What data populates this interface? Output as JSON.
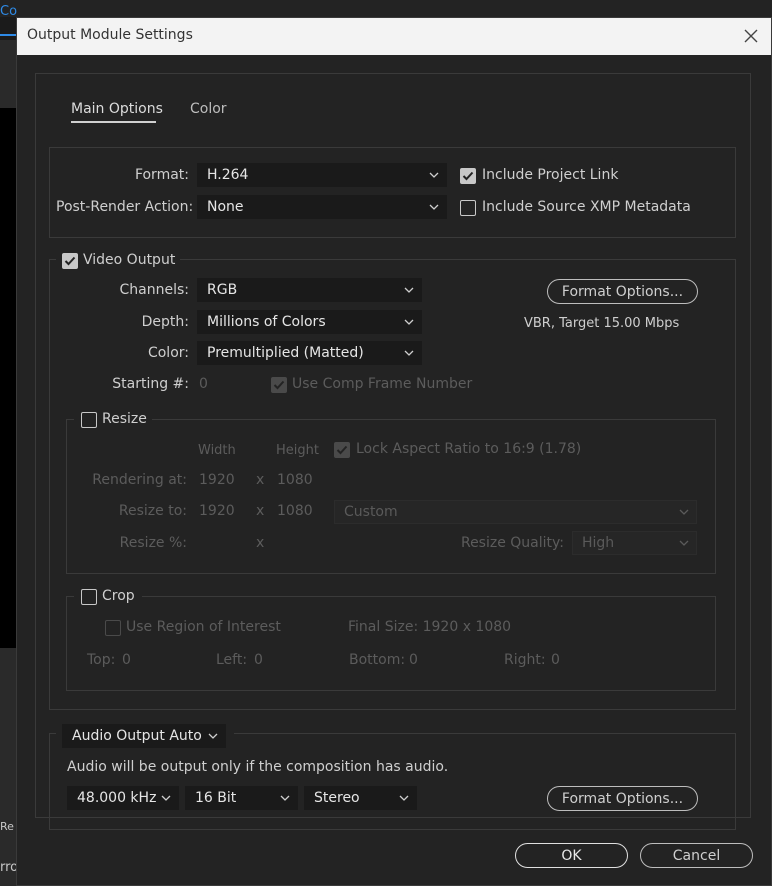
{
  "background": {
    "tab_fragment": "Co",
    "text_fragment_1": "Re",
    "text_fragment_2": "rro"
  },
  "dialog": {
    "title": "Output Module Settings",
    "close_icon": "close-icon"
  },
  "tabs": [
    {
      "label": "Main Options",
      "active": true
    },
    {
      "label": "Color",
      "active": false
    }
  ],
  "format_section": {
    "format_label": "Format:",
    "format_value": "H.264",
    "post_render_label": "Post-Render Action:",
    "post_render_value": "None",
    "include_project_link": {
      "label": "Include Project Link",
      "checked": true
    },
    "include_source_xmp": {
      "label": "Include Source XMP Metadata",
      "checked": false
    }
  },
  "video_output": {
    "label": "Video Output",
    "checked": true,
    "channels_label": "Channels:",
    "channels_value": "RGB",
    "depth_label": "Depth:",
    "depth_value": "Millions of Colors",
    "color_label": "Color:",
    "color_value": "Premultiplied (Matted)",
    "starting_label": "Starting #:",
    "starting_value": "0",
    "use_comp_frame": {
      "label": "Use Comp Frame Number",
      "checked": true,
      "enabled": false
    },
    "format_options_label": "Format Options...",
    "format_summary": "VBR, Target 15.00 Mbps"
  },
  "resize": {
    "label": "Resize",
    "checked": false,
    "width_header": "Width",
    "height_header": "Height",
    "lock_aspect": {
      "label": "Lock Aspect Ratio to 16:9 (1.78)",
      "checked": true,
      "enabled": false
    },
    "rendering_at_label": "Rendering at:",
    "rendering_w": "1920",
    "rendering_h": "1080",
    "resize_to_label": "Resize to:",
    "resize_w": "1920",
    "resize_h": "1080",
    "preset_value": "Custom",
    "resize_pct_label": "Resize %:",
    "x_sep": "x",
    "quality_label": "Resize Quality:",
    "quality_value": "High"
  },
  "crop": {
    "label": "Crop",
    "checked": false,
    "use_roi": {
      "label": "Use Region of Interest",
      "checked": false
    },
    "final_size": "Final Size: 1920 x 1080",
    "top_label": "Top:",
    "top_value": "0",
    "left_label": "Left:",
    "left_value": "0",
    "bottom_label": "Bottom:",
    "bottom_value": "0",
    "right_label": "Right:",
    "right_value": "0"
  },
  "audio": {
    "mode_value": "Audio Output Auto",
    "info": "Audio will be output only if the composition has audio.",
    "rate_value": "48.000 kHz",
    "depth_value": "16 Bit",
    "channels_value": "Stereo",
    "format_options_label": "Format Options..."
  },
  "footer": {
    "ok_label": "OK",
    "cancel_label": "Cancel"
  }
}
